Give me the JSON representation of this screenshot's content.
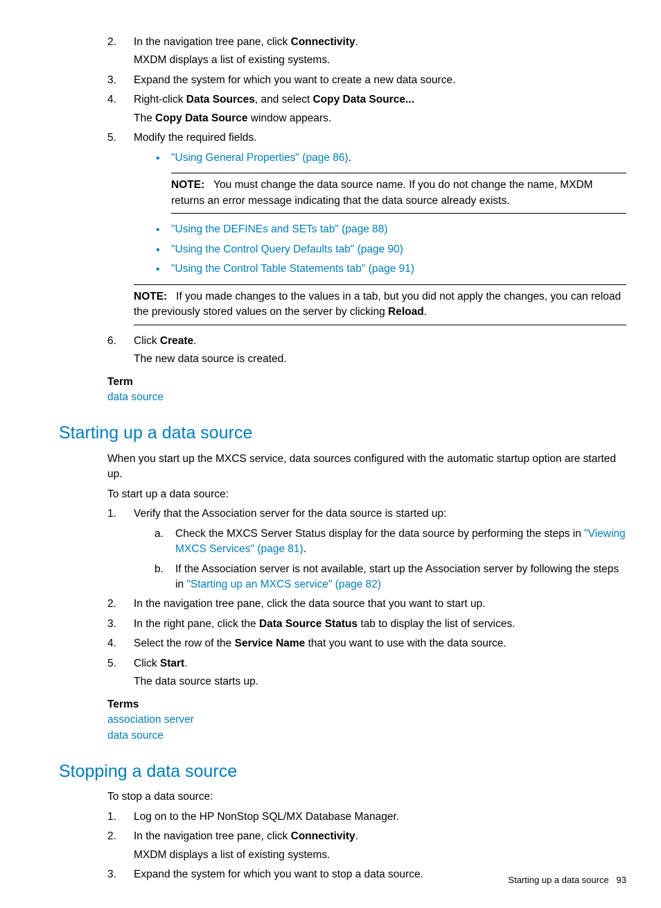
{
  "sec1": {
    "step2_a": "In the navigation tree pane, click ",
    "step2_bold": "Connectivity",
    "step2_b": ".",
    "step2_sub": "MXDM displays a list of existing systems.",
    "step3": "Expand the system for which you want to create a new data source.",
    "step4_a": "Right-click ",
    "step4_bold1": "Data Sources",
    "step4_b": ", and select ",
    "step4_bold2": "Copy Data Source...",
    "step4_sub_a": "The ",
    "step4_sub_bold": "Copy Data Source",
    "step4_sub_b": " window appears.",
    "step5": "Modify the required fields.",
    "bullet1_link": "\"Using General Properties\" (page 86)",
    "bullet1_after": ".",
    "note1_label": "NOTE:",
    "note1_text": "You must change the data source name. If you do not change the name, MXDM returns an error message indicating that the data source already exists.",
    "bullet2_link": "\"Using the DEFINEs and SETs tab\" (page 88)",
    "bullet3_link": "\"Using the Control Query Defaults tab\" (page 90)",
    "bullet4_link": "\"Using the Control Table Statements tab\" (page 91)",
    "note2_label": "NOTE:",
    "note2_text_a": "If you made changes to the values in a tab, but you did not apply the changes, you can reload the previously stored values on the server by clicking ",
    "note2_bold": "Reload",
    "note2_text_b": ".",
    "step6_a": "Click ",
    "step6_bold": "Create",
    "step6_b": ".",
    "step6_sub": "The new data source is created.",
    "term_head": "Term",
    "term_link": "data source"
  },
  "sec2": {
    "heading": "Starting up a data source",
    "intro": "When you start up the MXCS service, data sources configured with the automatic startup option are started up.",
    "intro2": "To start up a data source:",
    "step1": "Verify that the Association server for the data source is started up:",
    "step1a_a": "Check the MXCS Server Status display for the data source by performing the steps in ",
    "step1a_link": "\"Viewing MXCS Services\" (page 81)",
    "step1a_b": ".",
    "step1b_a": "If the Association server is not available, start up the Association server by following the steps in ",
    "step1b_link": "\"Starting up an MXCS service\" (page 82)",
    "step2": "In the navigation tree pane, click the data source that you want to start up.",
    "step3_a": "In the right pane, click the ",
    "step3_bold": "Data Source Status",
    "step3_b": " tab to display the list of services.",
    "step4_a": "Select the row of the ",
    "step4_bold": "Service Name",
    "step4_b": " that you want to use with the data source.",
    "step5_a": "Click ",
    "step5_bold": "Start",
    "step5_b": ".",
    "step5_sub": "The data source starts up.",
    "terms_head": "Terms",
    "terms_link1": "association server",
    "terms_link2": "data source"
  },
  "sec3": {
    "heading": "Stopping a data source",
    "intro": "To stop a data source:",
    "step1": "Log on to the HP NonStop SQL/MX Database Manager.",
    "step2_a": "In the navigation tree pane, click ",
    "step2_bold": "Connectivity",
    "step2_b": ".",
    "step2_sub": "MXDM displays a list of existing systems.",
    "step3": "Expand the system for which you want to stop a data source."
  },
  "footer": {
    "text": "Starting up a data source",
    "page": "93"
  },
  "nums": {
    "n1": "1.",
    "n2": "2.",
    "n3": "3.",
    "n4": "4.",
    "n5": "5.",
    "n6": "6.",
    "la": "a.",
    "lb": "b."
  }
}
